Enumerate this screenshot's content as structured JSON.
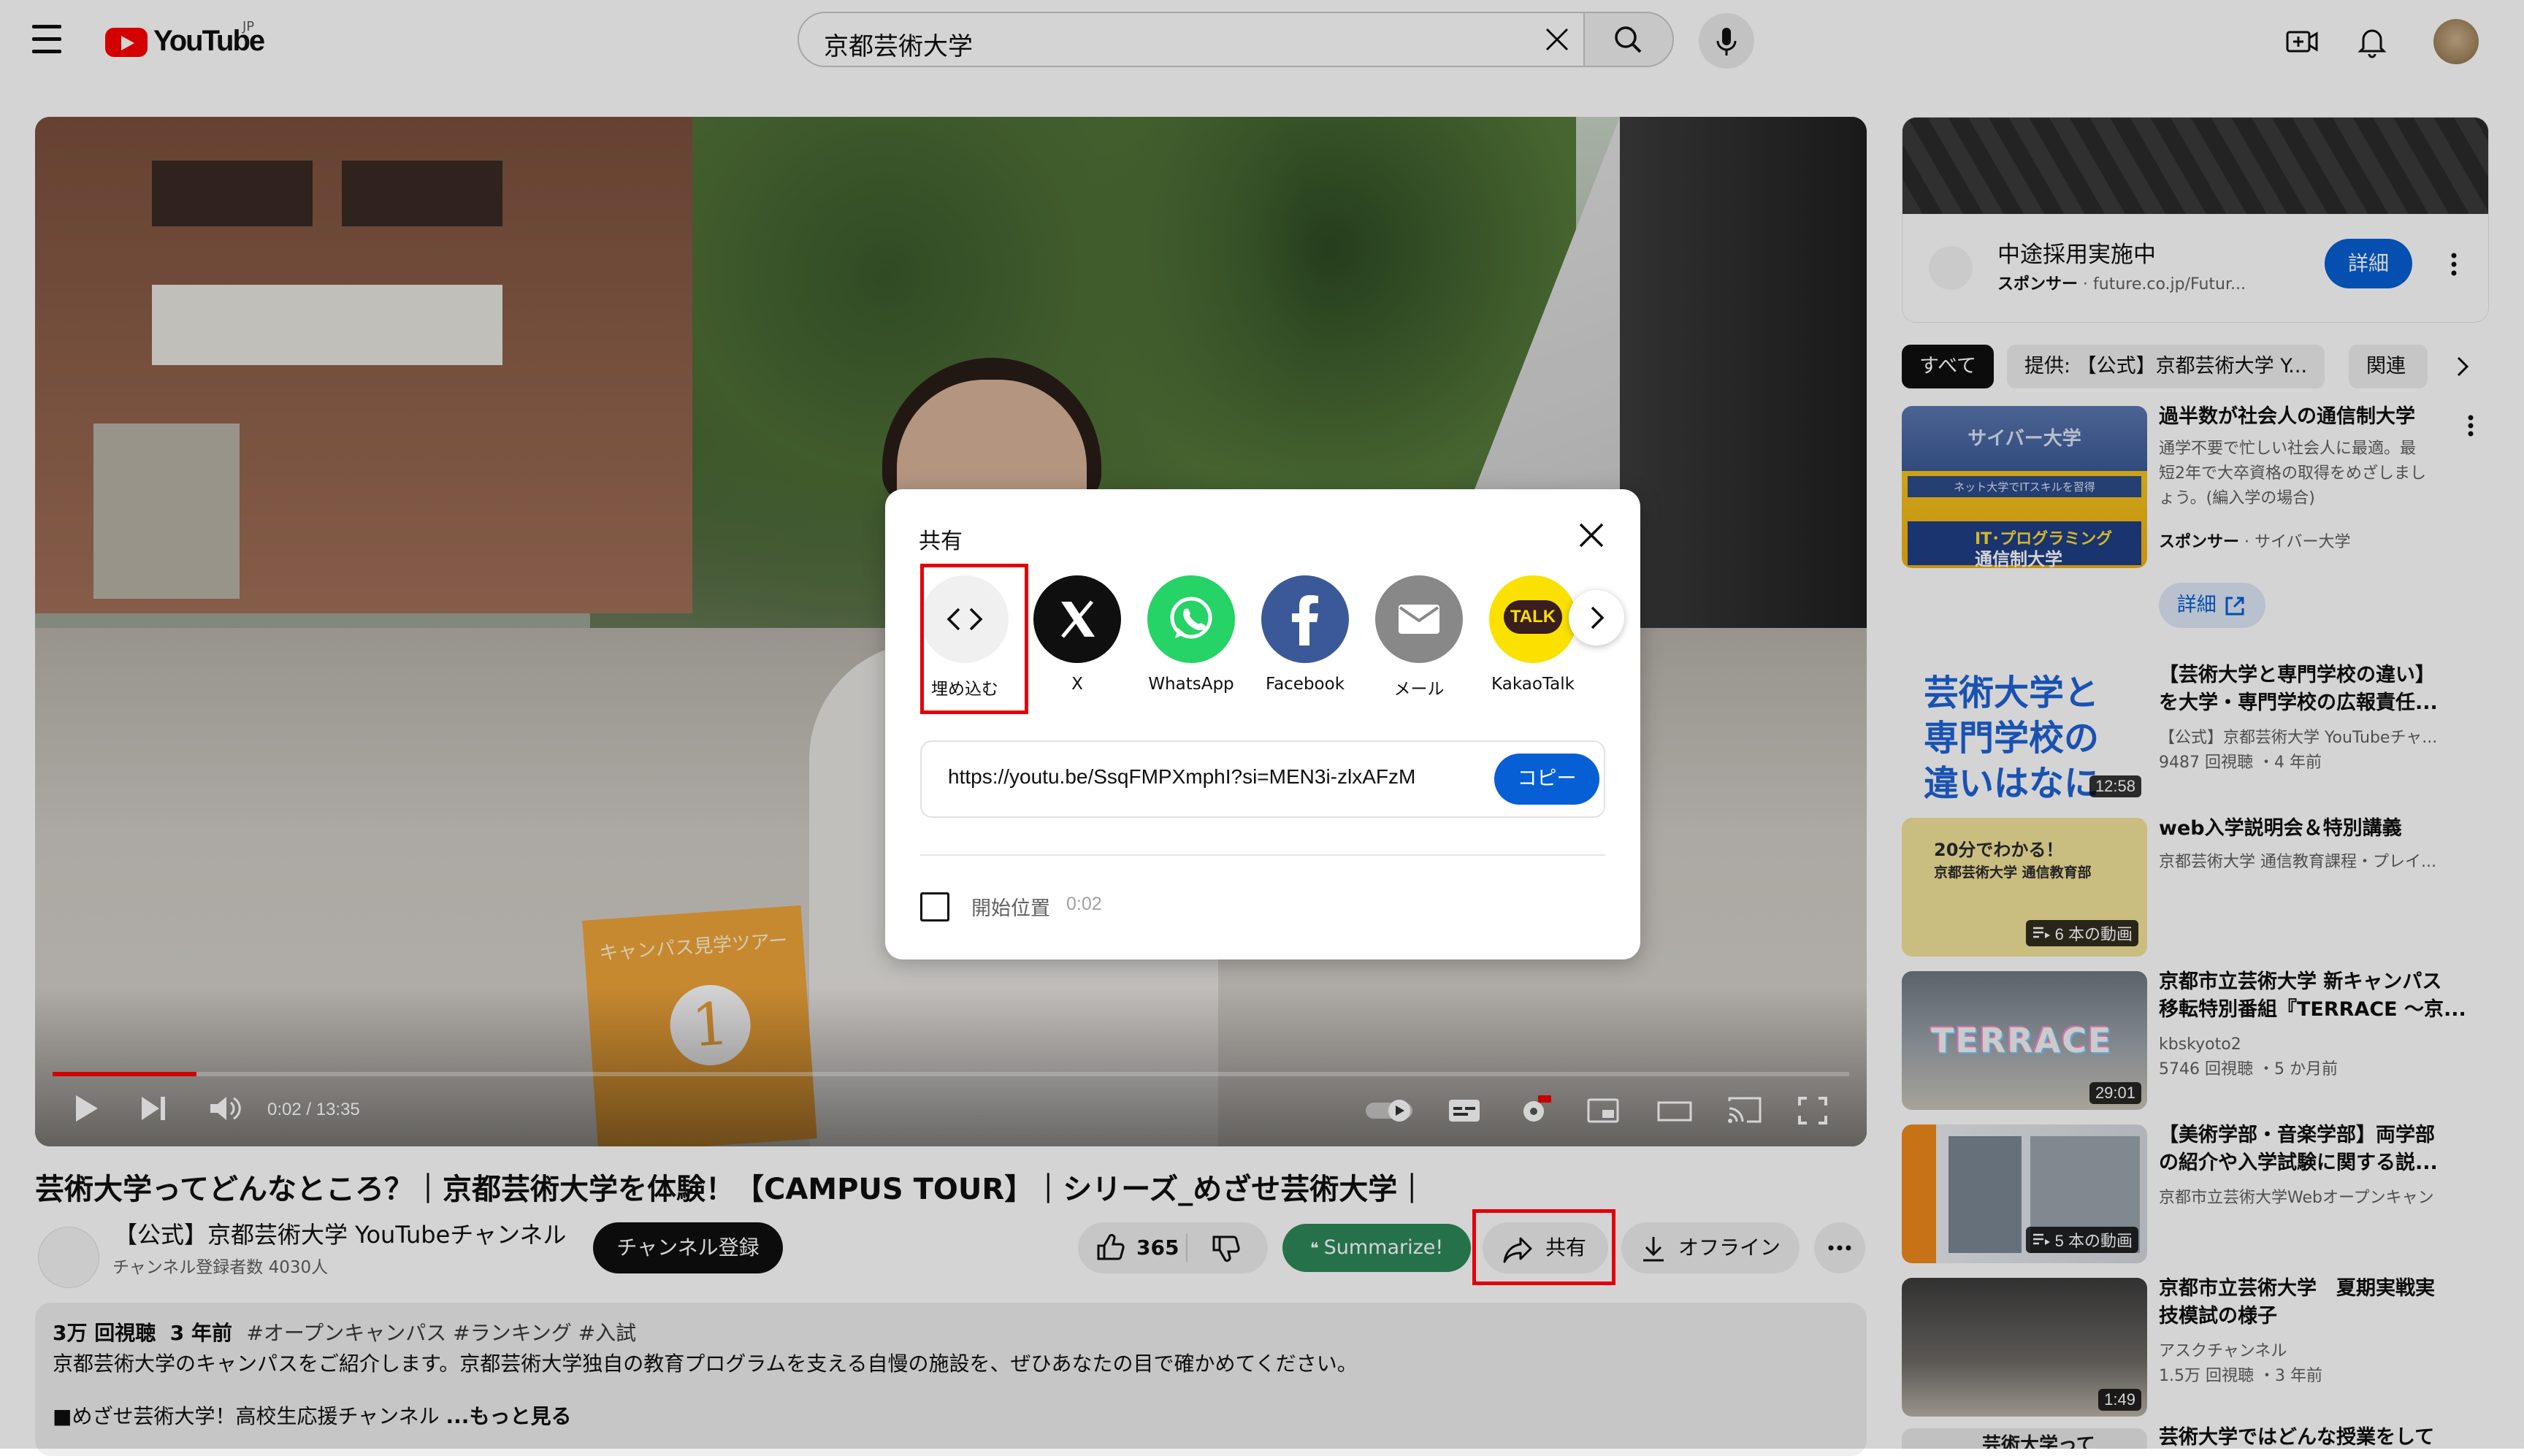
{
  "header": {
    "logo_text": "YouTube",
    "logo_region": "JP",
    "search_value": "京都芸術大学"
  },
  "player": {
    "time_label": "0:02 / 13:35",
    "progress": 0.003,
    "flag_text": "キャンパス見学ツアー",
    "flag_number": "1"
  },
  "video": {
    "title": "芸術大学ってどんなところ？｜京都芸術大学を体験！【CAMPUS TOUR】｜シリーズ_めざせ芸術大学｜",
    "channel_name": "【公式】京都芸術大学 YouTubeチャンネル",
    "channel_subs": "チャンネル登録者数 4030人",
    "subscribe_label": "チャンネル登録",
    "like_count": "365",
    "summarize_label": "Summarize!",
    "share_label": "共有",
    "download_label": "オフライン"
  },
  "description": {
    "views": "3万 回視聴",
    "age": "3 年前",
    "tags": "#オープンキャンパス #ランキング #入試",
    "line1": "京都芸術大学のキャンパスをご紹介します。京都芸術大学独自の教育プログラムを支える自慢の施設を、ぜひあなたの目で確かめてください。",
    "line2": "■めざせ芸術大学！高校生応援チャンネル",
    "more": "...もっと見る"
  },
  "ad": {
    "title": "中途採用実施中",
    "sponsor_label": "スポンサー",
    "sponsor_url": "future.co.jp/Futur...",
    "cta": "詳細"
  },
  "chips": [
    "すべて",
    "提供: 【公式】京都芸術大学 Y...",
    "関連"
  ],
  "recommendations": [
    {
      "title_lines": [
        "過半数が社会人の通信制大学"
      ],
      "meta_lines": [
        "通学不要で忙しい社会人に最適。最",
        "短2年で大卒資格の取得をめざしまし",
        "ょう。(編入学の場合)"
      ],
      "sponsor": "スポンサー",
      "sponsor_name": "サイバー大学",
      "cta": "詳細",
      "thumb_text": [
        "サイバー大学",
        "ネット大学でITスキルを習得",
        "IT･プログラミング",
        "通信制大学"
      ]
    },
    {
      "title_lines": [
        "【芸術大学と専門学校の違い】",
        "を大学・専門学校の広報責任..."
      ],
      "meta_lines": [
        "【公式】京都芸術大学 YouTubeチャ...",
        "9487 回視聴 ・4 年前"
      ],
      "duration": "12:58",
      "thumb_text": [
        "芸術大学と",
        "専門学校の",
        "違いはなに"
      ]
    },
    {
      "title_lines": [
        "web入学説明会＆特別講義"
      ],
      "meta_lines": [
        "京都芸術大学 通信教育課程・プレイ..."
      ],
      "playlist": "6 本の動画",
      "thumb_text": [
        "20分でわかる！",
        "京都芸術大学 通信教育部"
      ]
    },
    {
      "title_lines": [
        "京都市立芸術大学 新キャンパス",
        "移転特別番組『TERRACE 〜京..."
      ],
      "meta_lines": [
        "kbskyoto2",
        "5746 回視聴 ・5 か月前"
      ],
      "duration": "29:01",
      "thumb_text": [
        "TERRACE"
      ]
    },
    {
      "title_lines": [
        "【美術学部・音楽学部】両学部",
        "の紹介や入学試験に関する説..."
      ],
      "meta_lines": [
        "京都市立芸術大学Webオープンキャン"
      ],
      "playlist": "5 本の動画"
    },
    {
      "title_lines": [
        "京都市立芸術大学　夏期実戦実",
        "技模試の様子"
      ],
      "meta_lines": [
        "アスクチャンネル",
        "1.5万 回視聴 ・3 年前"
      ],
      "duration": "1:49"
    },
    {
      "title_lines": [
        "芸術大学ではどんな授業をして"
      ],
      "meta_lines": [],
      "thumb_text": [
        "芸術大学って"
      ]
    }
  ],
  "share_dialog": {
    "title": "共有",
    "targets": [
      {
        "label": "埋め込む",
        "icon": "embed-icon"
      },
      {
        "label": "X",
        "icon": "x-icon"
      },
      {
        "label": "WhatsApp",
        "icon": "whatsapp-icon"
      },
      {
        "label": "Facebook",
        "icon": "facebook-icon"
      },
      {
        "label": "メール",
        "icon": "mail-icon"
      },
      {
        "label": "KakaoTalk",
        "icon": "kakaotalk-icon"
      }
    ],
    "kakao_badge": "TALK",
    "url": "https://youtu.be/SsqFMPXmphI?si=MEN3i-zlxAFzM",
    "copy_label": "コピー",
    "start_label": "開始位置",
    "start_time": "0:02"
  },
  "colors": {
    "youtube_red": "#ff0000",
    "primary_blue": "#065fd4",
    "summarize_green": "#2d8a5a",
    "highlight_red": "#e3000b",
    "x_black": "#0f0f0f",
    "whatsapp_green": "#25d366",
    "facebook_blue": "#3b5998",
    "mail_gray": "#888888",
    "kakao_yellow": "#fae100"
  }
}
